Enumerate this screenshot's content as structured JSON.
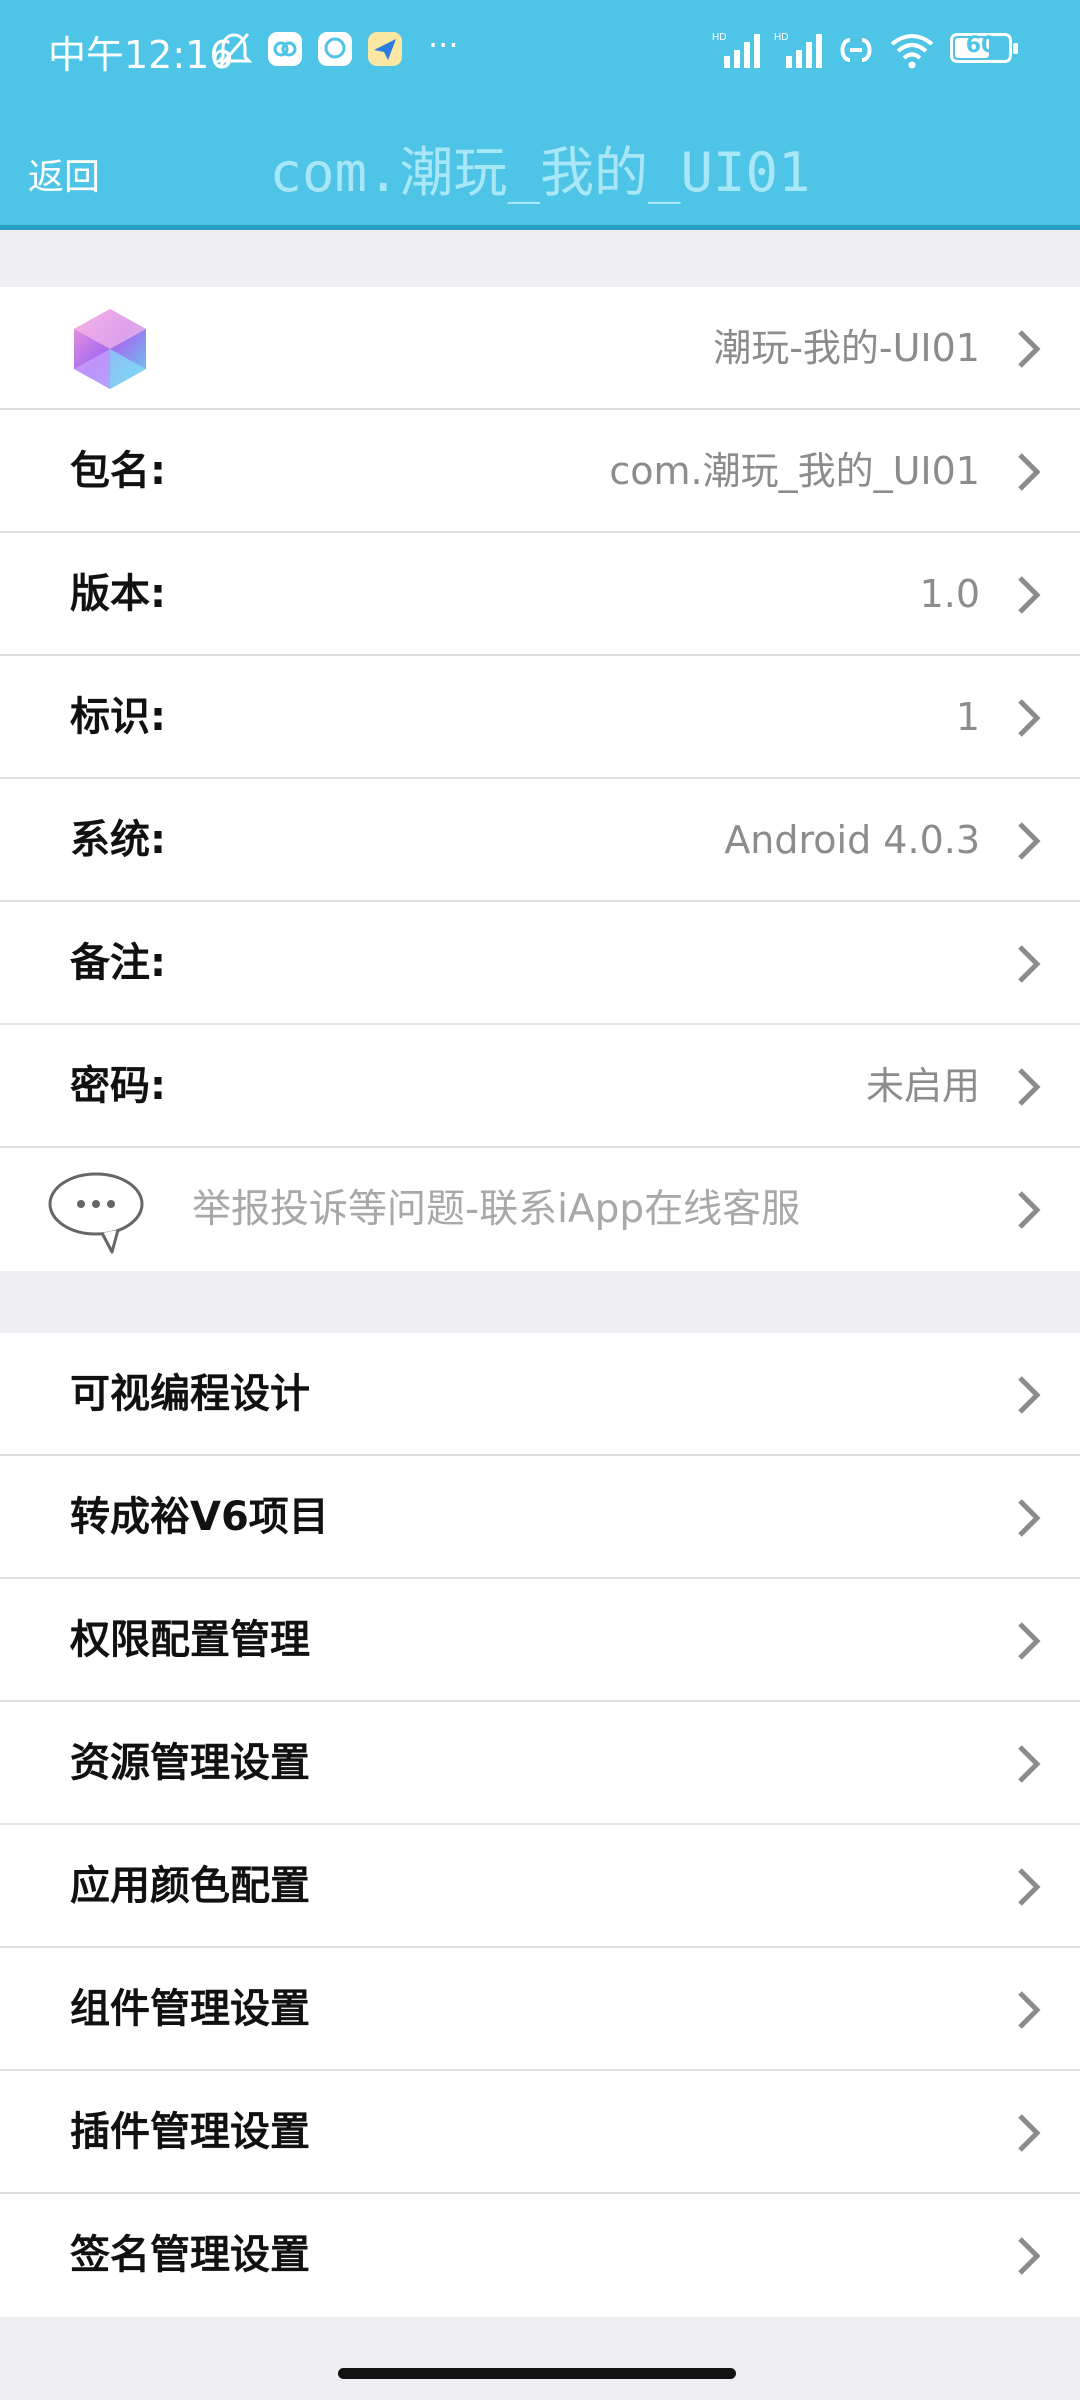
{
  "status_bar": {
    "time": "中午12:16",
    "more": "···",
    "battery": "60"
  },
  "header": {
    "back_label": "返回",
    "title": "com.潮玩_我的_UI01"
  },
  "app_info": {
    "app_name": "潮玩-我的-UI01",
    "rows": [
      {
        "label": "包名:",
        "value": "com.潮玩_我的_UI01"
      },
      {
        "label": "版本:",
        "value": "1.0"
      },
      {
        "label": "标识:",
        "value": "1"
      },
      {
        "label": "系统:",
        "value": "Android 4.0.3"
      },
      {
        "label": "备注:",
        "value": ""
      },
      {
        "label": "密码:",
        "value": "未启用"
      }
    ],
    "report_text": "举报投诉等问题-联系iApp在线客服"
  },
  "settings_menu": {
    "items": [
      "可视编程设计",
      "转成裕V6项目",
      "权限配置管理",
      "资源管理设置",
      "应用颜色配置",
      "组件管理设置",
      "插件管理设置",
      "签名管理设置"
    ]
  },
  "colors": {
    "header_bg": "#4ec4e6",
    "title_text": "#a7e7f7",
    "page_bg": "#efeff3"
  }
}
